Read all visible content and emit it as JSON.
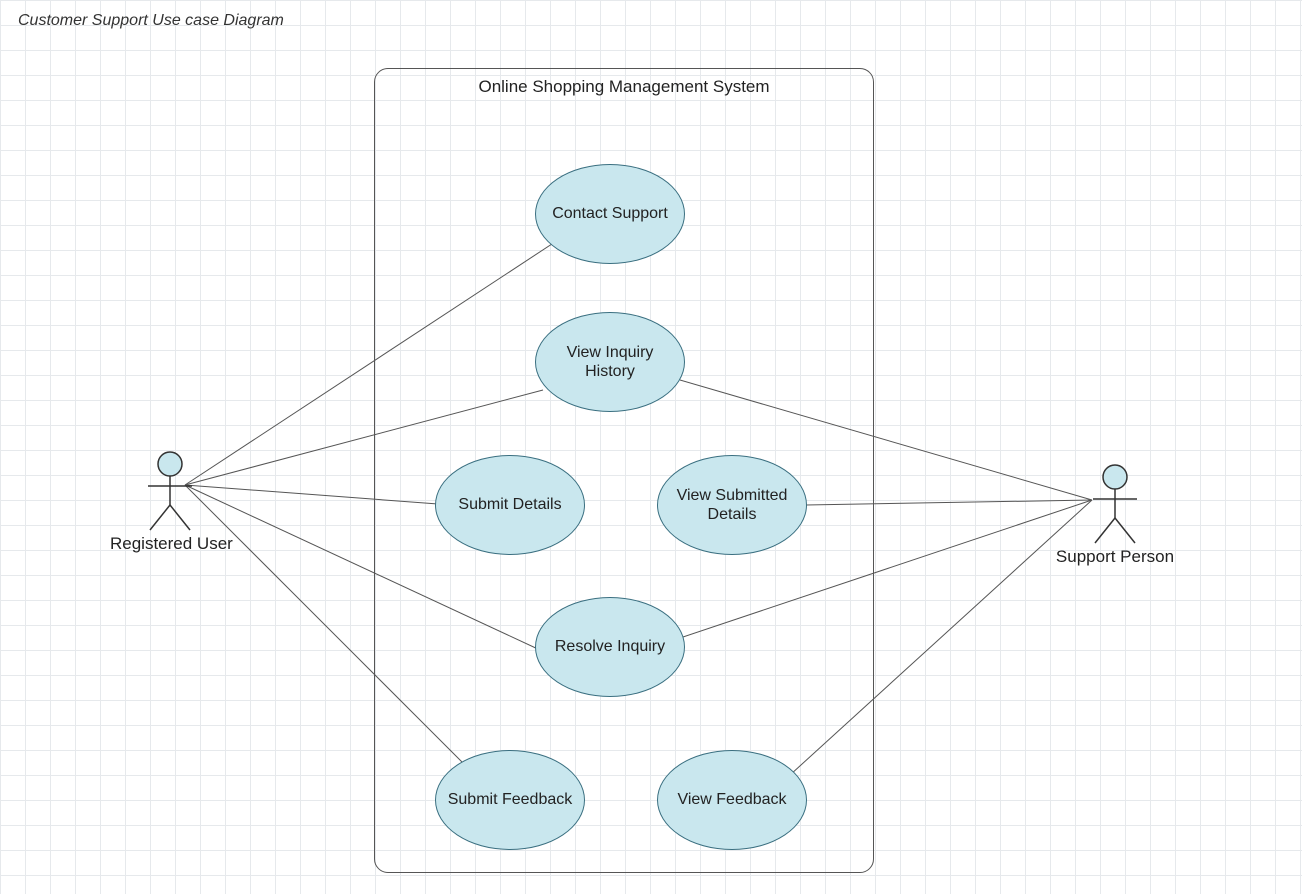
{
  "diagram": {
    "title": "Customer Support Use case Diagram",
    "system_name": "Online Shopping Management System",
    "actors": {
      "left": "Registered User",
      "right": "Support Person"
    },
    "usecases": {
      "contact_support": "Contact Support",
      "view_inquiry_history": "View Inquiry History",
      "submit_details": "Submit Details",
      "view_submitted_details": "View Submitted Details",
      "resolve_inquiry": "Resolve Inquiry",
      "submit_feedback": "Submit Feedback",
      "view_feedback": "View Feedback"
    },
    "associations": [
      {
        "actor": "left",
        "usecase": "contact_support"
      },
      {
        "actor": "left",
        "usecase": "view_inquiry_history"
      },
      {
        "actor": "left",
        "usecase": "submit_details"
      },
      {
        "actor": "left",
        "usecase": "resolve_inquiry"
      },
      {
        "actor": "left",
        "usecase": "submit_feedback"
      },
      {
        "actor": "right",
        "usecase": "view_inquiry_history"
      },
      {
        "actor": "right",
        "usecase": "view_submitted_details"
      },
      {
        "actor": "right",
        "usecase": "resolve_inquiry"
      },
      {
        "actor": "right",
        "usecase": "view_feedback"
      }
    ]
  }
}
